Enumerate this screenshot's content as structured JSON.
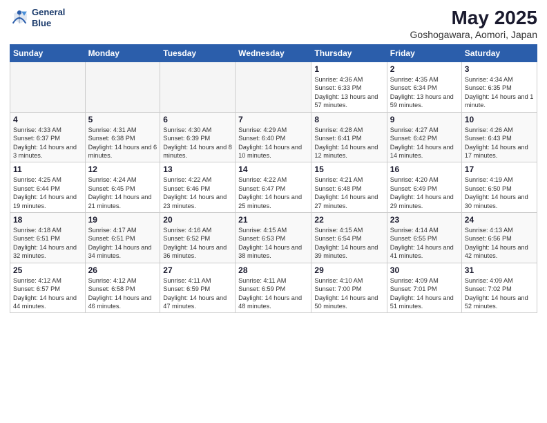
{
  "logo": {
    "line1": "General",
    "line2": "Blue"
  },
  "title": "May 2025",
  "subtitle": "Goshogawara, Aomori, Japan",
  "days_of_week": [
    "Sunday",
    "Monday",
    "Tuesday",
    "Wednesday",
    "Thursday",
    "Friday",
    "Saturday"
  ],
  "weeks": [
    [
      {
        "day": "",
        "empty": true
      },
      {
        "day": "",
        "empty": true
      },
      {
        "day": "",
        "empty": true
      },
      {
        "day": "",
        "empty": true
      },
      {
        "day": "1",
        "sunrise": "4:36 AM",
        "sunset": "6:33 PM",
        "daylight": "13 hours and 57 minutes."
      },
      {
        "day": "2",
        "sunrise": "4:35 AM",
        "sunset": "6:34 PM",
        "daylight": "13 hours and 59 minutes."
      },
      {
        "day": "3",
        "sunrise": "4:34 AM",
        "sunset": "6:35 PM",
        "daylight": "14 hours and 1 minute."
      }
    ],
    [
      {
        "day": "4",
        "sunrise": "4:33 AM",
        "sunset": "6:37 PM",
        "daylight": "14 hours and 3 minutes."
      },
      {
        "day": "5",
        "sunrise": "4:31 AM",
        "sunset": "6:38 PM",
        "daylight": "14 hours and 6 minutes."
      },
      {
        "day": "6",
        "sunrise": "4:30 AM",
        "sunset": "6:39 PM",
        "daylight": "14 hours and 8 minutes."
      },
      {
        "day": "7",
        "sunrise": "4:29 AM",
        "sunset": "6:40 PM",
        "daylight": "14 hours and 10 minutes."
      },
      {
        "day": "8",
        "sunrise": "4:28 AM",
        "sunset": "6:41 PM",
        "daylight": "14 hours and 12 minutes."
      },
      {
        "day": "9",
        "sunrise": "4:27 AM",
        "sunset": "6:42 PM",
        "daylight": "14 hours and 14 minutes."
      },
      {
        "day": "10",
        "sunrise": "4:26 AM",
        "sunset": "6:43 PM",
        "daylight": "14 hours and 17 minutes."
      }
    ],
    [
      {
        "day": "11",
        "sunrise": "4:25 AM",
        "sunset": "6:44 PM",
        "daylight": "14 hours and 19 minutes."
      },
      {
        "day": "12",
        "sunrise": "4:24 AM",
        "sunset": "6:45 PM",
        "daylight": "14 hours and 21 minutes."
      },
      {
        "day": "13",
        "sunrise": "4:22 AM",
        "sunset": "6:46 PM",
        "daylight": "14 hours and 23 minutes."
      },
      {
        "day": "14",
        "sunrise": "4:22 AM",
        "sunset": "6:47 PM",
        "daylight": "14 hours and 25 minutes."
      },
      {
        "day": "15",
        "sunrise": "4:21 AM",
        "sunset": "6:48 PM",
        "daylight": "14 hours and 27 minutes."
      },
      {
        "day": "16",
        "sunrise": "4:20 AM",
        "sunset": "6:49 PM",
        "daylight": "14 hours and 29 minutes."
      },
      {
        "day": "17",
        "sunrise": "4:19 AM",
        "sunset": "6:50 PM",
        "daylight": "14 hours and 30 minutes."
      }
    ],
    [
      {
        "day": "18",
        "sunrise": "4:18 AM",
        "sunset": "6:51 PM",
        "daylight": "14 hours and 32 minutes."
      },
      {
        "day": "19",
        "sunrise": "4:17 AM",
        "sunset": "6:51 PM",
        "daylight": "14 hours and 34 minutes."
      },
      {
        "day": "20",
        "sunrise": "4:16 AM",
        "sunset": "6:52 PM",
        "daylight": "14 hours and 36 minutes."
      },
      {
        "day": "21",
        "sunrise": "4:15 AM",
        "sunset": "6:53 PM",
        "daylight": "14 hours and 38 minutes."
      },
      {
        "day": "22",
        "sunrise": "4:15 AM",
        "sunset": "6:54 PM",
        "daylight": "14 hours and 39 minutes."
      },
      {
        "day": "23",
        "sunrise": "4:14 AM",
        "sunset": "6:55 PM",
        "daylight": "14 hours and 41 minutes."
      },
      {
        "day": "24",
        "sunrise": "4:13 AM",
        "sunset": "6:56 PM",
        "daylight": "14 hours and 42 minutes."
      }
    ],
    [
      {
        "day": "25",
        "sunrise": "4:12 AM",
        "sunset": "6:57 PM",
        "daylight": "14 hours and 44 minutes."
      },
      {
        "day": "26",
        "sunrise": "4:12 AM",
        "sunset": "6:58 PM",
        "daylight": "14 hours and 46 minutes."
      },
      {
        "day": "27",
        "sunrise": "4:11 AM",
        "sunset": "6:59 PM",
        "daylight": "14 hours and 47 minutes."
      },
      {
        "day": "28",
        "sunrise": "4:11 AM",
        "sunset": "6:59 PM",
        "daylight": "14 hours and 48 minutes."
      },
      {
        "day": "29",
        "sunrise": "4:10 AM",
        "sunset": "7:00 PM",
        "daylight": "14 hours and 50 minutes."
      },
      {
        "day": "30",
        "sunrise": "4:09 AM",
        "sunset": "7:01 PM",
        "daylight": "14 hours and 51 minutes."
      },
      {
        "day": "31",
        "sunrise": "4:09 AM",
        "sunset": "7:02 PM",
        "daylight": "14 hours and 52 minutes."
      }
    ]
  ],
  "labels": {
    "sunrise": "Sunrise:",
    "sunset": "Sunset:",
    "daylight": "Daylight:"
  }
}
